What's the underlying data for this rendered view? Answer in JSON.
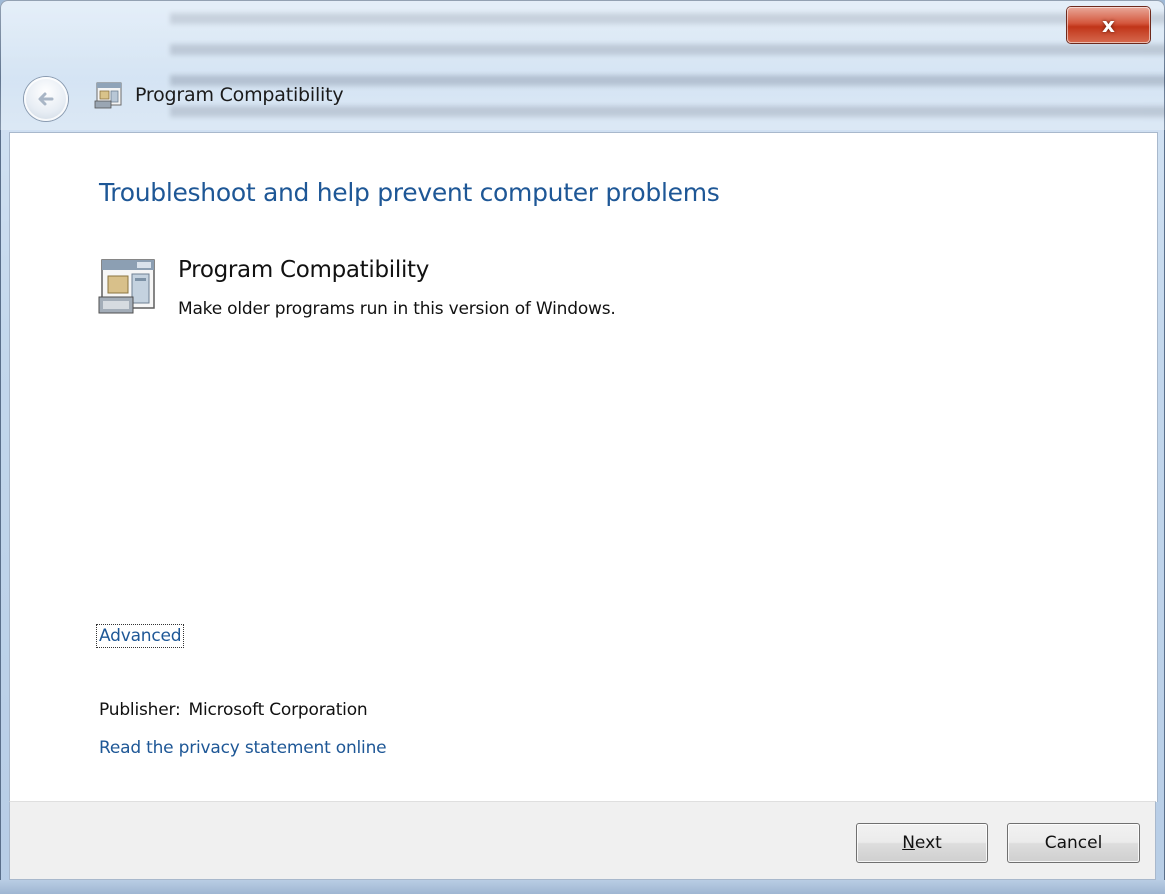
{
  "window": {
    "title": "Program Compatibility",
    "close_label": "x"
  },
  "content": {
    "heading": "Troubleshoot and help prevent computer problems",
    "item": {
      "title": "Program Compatibility",
      "description": "Make older programs run in this version of Windows."
    },
    "advanced_link": "Advanced",
    "publisher_label": "Publisher:",
    "publisher_value": "Microsoft Corporation",
    "privacy_link": "Read the privacy statement online"
  },
  "footer": {
    "next_first": "N",
    "next_rest": "ext",
    "cancel_label": "Cancel"
  },
  "colors": {
    "link": "#1e5796",
    "heading": "#1e5796",
    "close_button": "#c13519"
  },
  "icons": {
    "back": "back-arrow-icon",
    "title": "program-compatibility-icon",
    "item": "program-compatibility-icon"
  }
}
